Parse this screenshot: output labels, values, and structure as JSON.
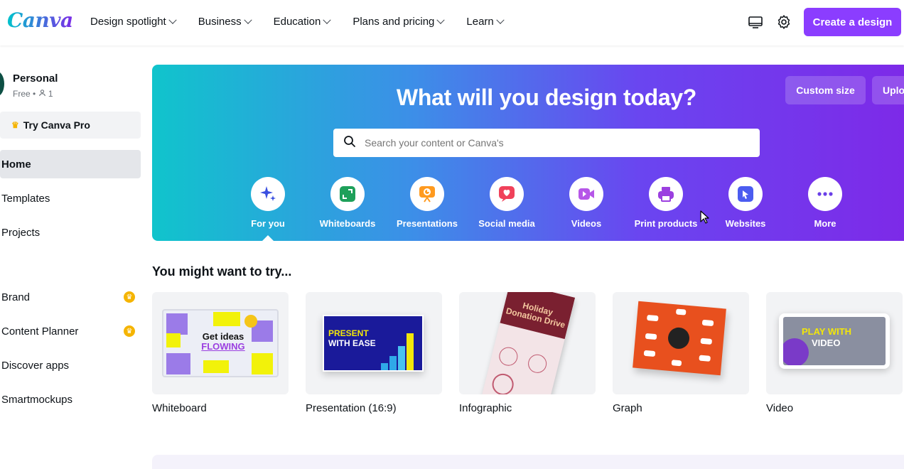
{
  "app": {
    "logo": "Canva"
  },
  "nav": [
    {
      "label": "Design spotlight"
    },
    {
      "label": "Business"
    },
    {
      "label": "Education"
    },
    {
      "label": "Plans and pricing"
    },
    {
      "label": "Learn"
    }
  ],
  "header": {
    "create_label": "Create a design",
    "icons": [
      "desktop-icon",
      "settings-icon"
    ]
  },
  "account": {
    "name": "Personal",
    "plan": "Free",
    "members": "1"
  },
  "sidebar": {
    "try_pro": "Try Canva Pro",
    "items": [
      {
        "label": "Home",
        "active": true
      },
      {
        "label": "Templates"
      },
      {
        "label": "Projects"
      },
      {
        "label": "Brand",
        "pro": true
      },
      {
        "label": "Content Planner",
        "pro": true
      },
      {
        "label": "Discover apps"
      },
      {
        "label": "Smartmockups"
      }
    ]
  },
  "hero": {
    "title": "What will you design today?",
    "custom_size": "Custom size",
    "upload": "Uplo",
    "search_placeholder": "Search your content or Canva's",
    "categories": [
      {
        "label": "For you",
        "icon": "sparkle-icon",
        "color": "#3a4fe0"
      },
      {
        "label": "Whiteboards",
        "icon": "whiteboard-icon",
        "color": "#1ea05a"
      },
      {
        "label": "Presentations",
        "icon": "presentation-icon",
        "color": "#ff9a1f"
      },
      {
        "label": "Social media",
        "icon": "heart-icon",
        "color": "#f0415a"
      },
      {
        "label": "Videos",
        "icon": "video-icon",
        "color": "#b657e8"
      },
      {
        "label": "Print products",
        "icon": "printer-icon",
        "color": "#9b3fe0"
      },
      {
        "label": "Websites",
        "icon": "website-icon",
        "color": "#4b5cf0"
      },
      {
        "label": "More",
        "icon": "more-icon",
        "color": "#6a3fe8"
      }
    ]
  },
  "suggestions": {
    "title": "You might want to try...",
    "cards": [
      {
        "label": "Whiteboard",
        "thumb_text": "Get ideas",
        "thumb_text2": "FLOWING"
      },
      {
        "label": "Presentation (16:9)",
        "thumb_text": "PRESENT",
        "thumb_text2": "WITH EASE"
      },
      {
        "label": "Infographic",
        "thumb_text": "Holiday",
        "thumb_text2": "Donation Drive"
      },
      {
        "label": "Graph",
        "thumb_text": "",
        "thumb_text2": ""
      },
      {
        "label": "Video",
        "thumb_text": "PLAY WITH",
        "thumb_text2": "VIDEO"
      }
    ]
  }
}
